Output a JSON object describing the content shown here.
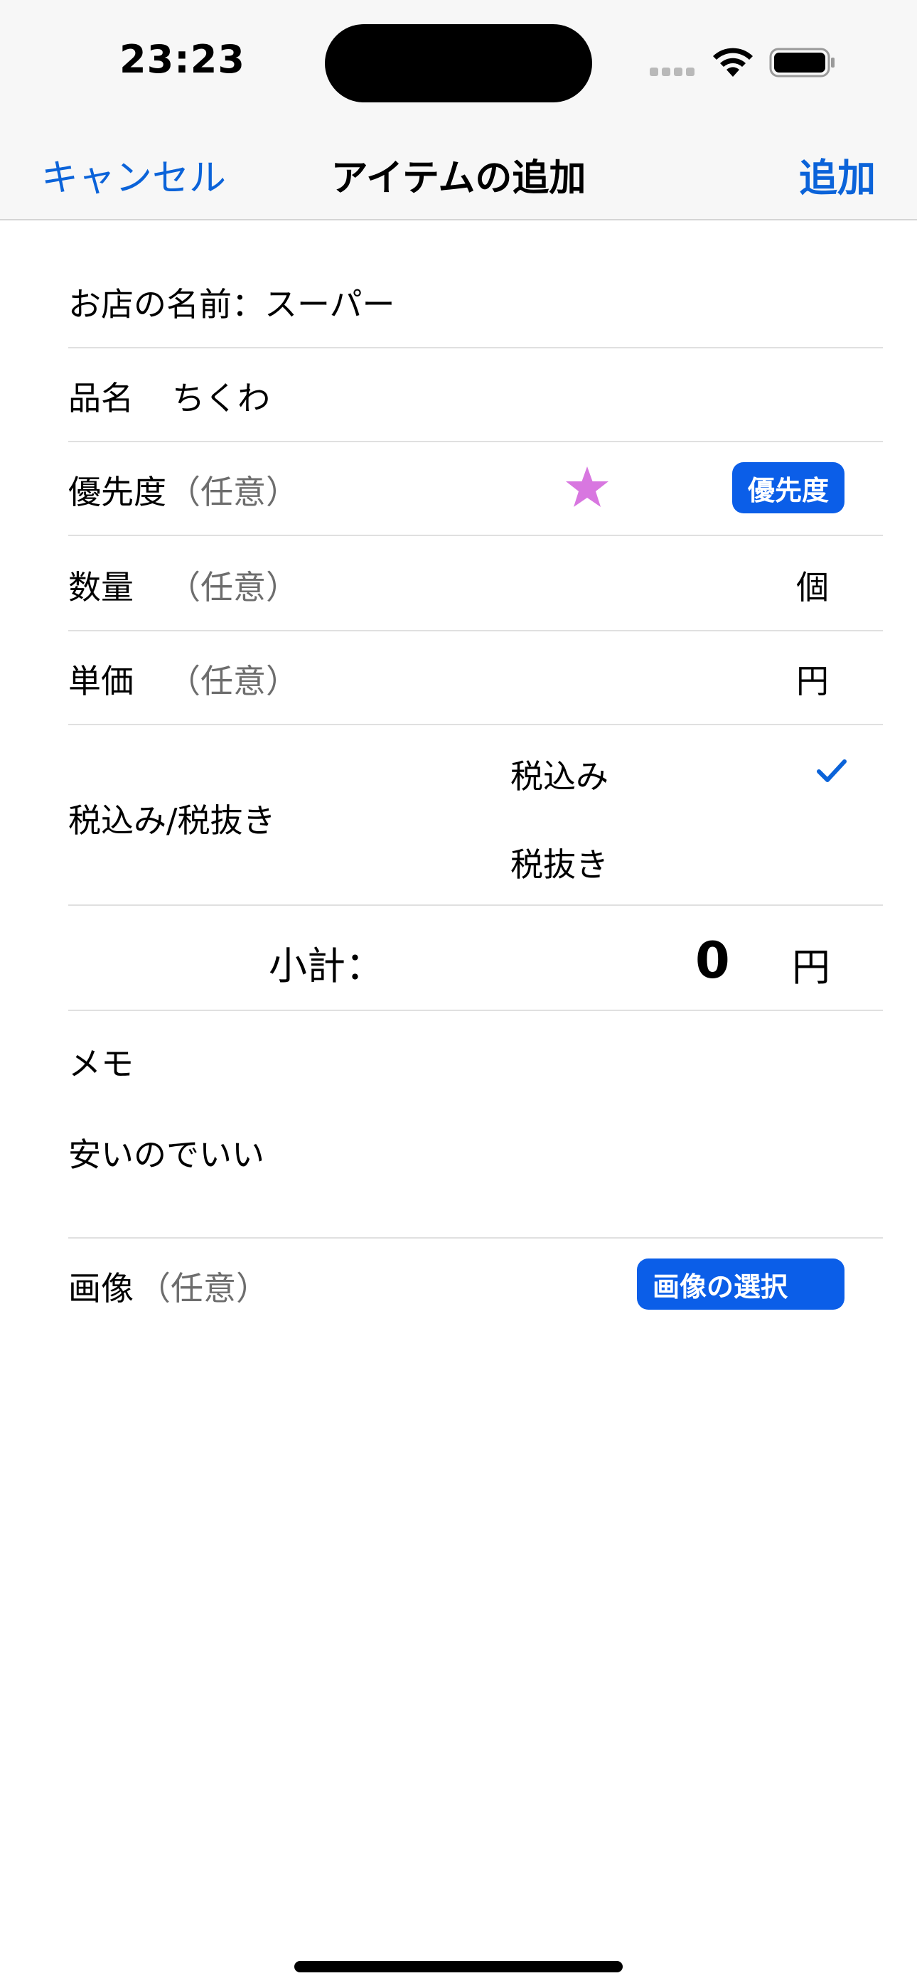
{
  "status_bar": {
    "time": "23:23"
  },
  "nav": {
    "cancel": "キャンセル",
    "title": "アイテムの追加",
    "add": "追加"
  },
  "form": {
    "store": "お店の名前：スーパー",
    "item_label": "品名",
    "item_value": "ちくわ",
    "priority_label": "優先度",
    "priority_optional": "（任意）",
    "priority_button": "優先度",
    "quantity_label": "数量",
    "quantity_optional": "（任意）",
    "quantity_unit": "個",
    "price_label": "単価",
    "price_optional": "（任意）",
    "price_unit": "円",
    "tax_label": "税込み/税抜き",
    "tax_options": [
      "税込み",
      "税抜き"
    ],
    "subtotal_label": "小計：",
    "subtotal_value": "0",
    "subtotal_unit": "円",
    "memo_label": "メモ",
    "memo_value": "安いのでいい",
    "image_label": "画像",
    "image_optional": "（任意）",
    "image_button": "画像の選択"
  },
  "colors": {
    "accent": "#0b63d9",
    "button": "#0b5ee8",
    "star": "#d877e0"
  },
  "icons": [
    "star-icon",
    "checkmark-icon",
    "wifi-icon",
    "battery-icon",
    "signal-icon"
  ]
}
